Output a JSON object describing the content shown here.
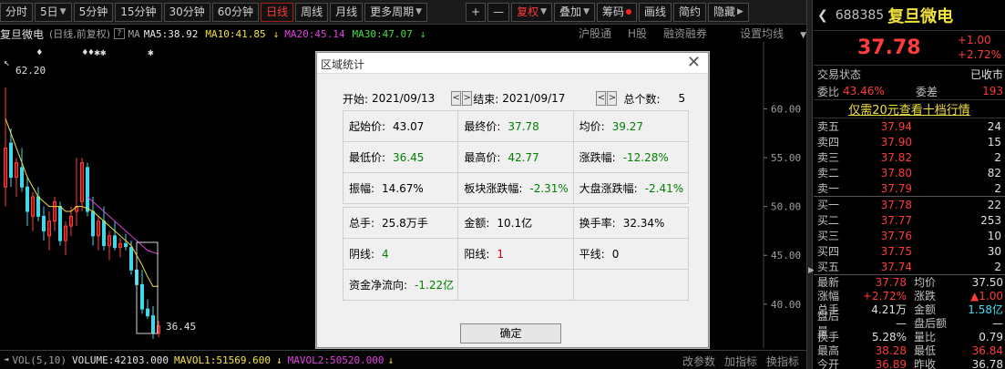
{
  "toolbar": {
    "buttons": [
      "分时",
      "5日",
      "5分钟",
      "15分钟",
      "30分钟",
      "60分钟",
      "日线",
      "周线",
      "月线",
      "更多周期"
    ],
    "plus": "+",
    "minus": "—",
    "fuquan": "复权",
    "diejia": "叠加",
    "chouma": "筹码",
    "huaxian": "画线",
    "jianyue": "简约",
    "yincang": "隐藏"
  },
  "ma_line": {
    "stock_name": "复旦微电",
    "mode": "(日线,前复权)",
    "qbox": "?",
    "ma_label": "MA",
    "ma5": "MA5:38.92",
    "ma10": "MA10:41.85",
    "ma20": "MA20:45.14",
    "ma30": "MA30:47.07",
    "arrow_down": "↓",
    "links": [
      "沪股通",
      "H股",
      "融资融券",
      "设置均线"
    ]
  },
  "chart": {
    "price_labels": [
      "60.00",
      "55.00",
      "50.00",
      "45.00",
      "40.00"
    ],
    "high_marker": "62.20",
    "low_marker": "36.45",
    "stars": [
      "♦",
      "♦♦✱✱",
      "✱"
    ]
  },
  "chart_data": {
    "type": "candlestick",
    "ylim": [
      35.5,
      65.0
    ],
    "y_ticks": [
      60.0,
      55.0,
      50.0,
      45.0,
      40.0
    ],
    "candles": [
      {
        "o": 52.0,
        "h": 62.2,
        "l": 50.0,
        "c": 56.0
      },
      {
        "o": 56.5,
        "h": 58.0,
        "l": 52.0,
        "c": 53.0
      },
      {
        "o": 53.0,
        "h": 55.0,
        "l": 51.0,
        "c": 54.5
      },
      {
        "o": 54.0,
        "h": 56.0,
        "l": 51.5,
        "c": 52.0
      },
      {
        "o": 52.0,
        "h": 53.0,
        "l": 48.0,
        "c": 49.5
      },
      {
        "o": 49.0,
        "h": 51.5,
        "l": 47.5,
        "c": 51.0
      },
      {
        "o": 51.0,
        "h": 52.0,
        "l": 48.5,
        "c": 49.0
      },
      {
        "o": 49.0,
        "h": 50.0,
        "l": 46.5,
        "c": 47.5
      },
      {
        "o": 47.0,
        "h": 49.5,
        "l": 45.5,
        "c": 48.5
      },
      {
        "o": 48.5,
        "h": 51.0,
        "l": 47.5,
        "c": 50.5
      },
      {
        "o": 50.0,
        "h": 50.5,
        "l": 46.0,
        "c": 46.5
      },
      {
        "o": 46.5,
        "h": 48.5,
        "l": 45.0,
        "c": 48.0
      },
      {
        "o": 48.0,
        "h": 50.0,
        "l": 47.0,
        "c": 49.0
      },
      {
        "o": 49.5,
        "h": 55.0,
        "l": 48.0,
        "c": 50.0
      },
      {
        "o": 50.5,
        "h": 55.0,
        "l": 49.5,
        "c": 54.5
      },
      {
        "o": 54.0,
        "h": 54.5,
        "l": 49.0,
        "c": 49.5
      },
      {
        "o": 49.5,
        "h": 51.0,
        "l": 46.0,
        "c": 47.0
      },
      {
        "o": 47.0,
        "h": 49.0,
        "l": 45.5,
        "c": 48.5
      },
      {
        "o": 48.5,
        "h": 50.0,
        "l": 45.5,
        "c": 46.0
      },
      {
        "o": 46.0,
        "h": 47.5,
        "l": 44.5,
        "c": 47.0
      },
      {
        "o": 47.0,
        "h": 48.5,
        "l": 45.5,
        "c": 45.8
      },
      {
        "o": 45.8,
        "h": 46.8,
        "l": 44.8,
        "c": 46.2
      },
      {
        "o": 46.2,
        "h": 47.2,
        "l": 45.5,
        "c": 45.9
      },
      {
        "o": 45.8,
        "h": 46.5,
        "l": 43.0,
        "c": 43.5
      },
      {
        "o": 43.5,
        "h": 44.5,
        "l": 41.5,
        "c": 42.0
      },
      {
        "o": 42.0,
        "h": 43.5,
        "l": 39.0,
        "c": 39.5
      },
      {
        "o": 39.5,
        "h": 40.5,
        "l": 38.5,
        "c": 38.8
      },
      {
        "o": 38.8,
        "h": 39.8,
        "l": 36.45,
        "c": 37.0
      },
      {
        "o": 37.0,
        "h": 38.3,
        "l": 36.6,
        "c": 37.78
      }
    ],
    "ma_series": [
      {
        "name": "MA10",
        "color": "#f0e040",
        "values": [
          59.0,
          57.5,
          56.0,
          54.5,
          53.0,
          52.0,
          51.0,
          50.5,
          50.0,
          50.0,
          50.0,
          49.5,
          49.5,
          50.0,
          50.0,
          49.8,
          49.5,
          49.0,
          48.5,
          48.0,
          47.5,
          47.0,
          46.5,
          46.0,
          45.0,
          44.0,
          42.8,
          41.8,
          41.85
        ]
      },
      {
        "name": "MA20",
        "color": "#e040e0",
        "values": [
          null,
          null,
          null,
          null,
          null,
          null,
          null,
          null,
          null,
          null,
          null,
          null,
          null,
          null,
          null,
          51.0,
          50.5,
          50.0,
          49.5,
          49.0,
          48.5,
          48.0,
          47.5,
          47.0,
          46.5,
          46.0,
          45.5,
          45.3,
          45.14
        ]
      }
    ]
  },
  "dialog": {
    "title": "区域统计",
    "close": "✕",
    "start_label": "开始:",
    "start_date": "2021/09/13",
    "end_label": "结束:",
    "end_date": "2021/09/17",
    "count_label": "总个数:",
    "count": "5",
    "nav_prev": "<",
    "nav_next": ">",
    "rows": [
      [
        {
          "label": "起始价:",
          "value": "43.07",
          "color": "black"
        },
        {
          "label": "最终价:",
          "value": "37.78",
          "color": "green"
        },
        {
          "label": "均价:",
          "value": "39.27",
          "color": "green"
        }
      ],
      [
        {
          "label": "最低价:",
          "value": "36.45",
          "color": "green"
        },
        {
          "label": "最高价:",
          "value": "42.77",
          "color": "green"
        },
        {
          "label": "涨跌幅:",
          "value": "-12.28%",
          "color": "green"
        }
      ],
      [
        {
          "label": "振幅:",
          "value": "14.67%",
          "color": "black"
        },
        {
          "label": "板块涨跌幅:",
          "value": "-2.31%",
          "color": "green"
        },
        {
          "label": "大盘涨跌幅:",
          "value": "-2.41%",
          "color": "green"
        }
      ],
      [
        {
          "label": "总手:",
          "value": "25.8万手",
          "color": "black"
        },
        {
          "label": "金额:",
          "value": "10.1亿",
          "color": "black"
        },
        {
          "label": "换手率:",
          "value": "32.34%",
          "color": "black"
        }
      ],
      [
        {
          "label": "阴线:",
          "value": "4",
          "color": "green"
        },
        {
          "label": "阳线:",
          "value": "1",
          "color": "red"
        },
        {
          "label": "平线:",
          "value": "0",
          "color": "black"
        }
      ],
      [
        {
          "label": "资金净流向:",
          "value": "-1.22亿",
          "color": "green"
        },
        {
          "label": "",
          "value": "",
          "color": "black"
        },
        {
          "label": "",
          "value": "",
          "color": "black"
        }
      ]
    ],
    "ok": "确定"
  },
  "vol_line": {
    "label": "VOL(5,10)",
    "volume": "VOLUME:42103.000",
    "mavol1": "MAVOL1:51569.600",
    "mavol2": "MAVOL2:50520.000",
    "arrow_down": "↓",
    "links": [
      "改参数",
      "加指标",
      "换指标"
    ]
  },
  "right_panel": {
    "chevron": "❮",
    "code": "688385",
    "name": "复旦微电",
    "price": "37.78",
    "change": "+1.00",
    "change_pct": "+2.72%",
    "trade_status_label": "交易状态",
    "trade_status": "已收市",
    "weibi_label": "委比",
    "weibi": "43.46%",
    "weicha_label": "委差",
    "weicha": "193",
    "link": "仅需20元查看十档行情",
    "asks": [
      {
        "label": "卖五",
        "price": "37.94",
        "vol": "24"
      },
      {
        "label": "卖四",
        "price": "37.90",
        "vol": "15"
      },
      {
        "label": "卖三",
        "price": "37.82",
        "vol": "2"
      },
      {
        "label": "卖二",
        "price": "37.80",
        "vol": "82"
      },
      {
        "label": "卖一",
        "price": "37.79",
        "vol": "2"
      }
    ],
    "bids": [
      {
        "label": "买一",
        "price": "37.78",
        "vol": "22"
      },
      {
        "label": "买二",
        "price": "37.77",
        "vol": "253"
      },
      {
        "label": "买三",
        "price": "37.76",
        "vol": "10"
      },
      {
        "label": "买四",
        "price": "37.75",
        "vol": "30"
      },
      {
        "label": "买五",
        "price": "37.74",
        "vol": "2"
      }
    ],
    "stats": [
      {
        "l1": "最新",
        "v1": "37.78",
        "c1": "red",
        "l2": "均价",
        "v2": "37.50",
        "c2": "white"
      },
      {
        "l1": "涨幅",
        "v1": "+2.72%",
        "c1": "red",
        "l2": "涨跌",
        "v2": "▲1.00",
        "c2": "red"
      },
      {
        "l1": "总手",
        "v1": "4.21万",
        "c1": "white",
        "l2": "金额",
        "v2": "1.58亿",
        "c2": "cyan"
      },
      {
        "l1": "盘后量",
        "v1": "—",
        "c1": "white",
        "l2": "盘后额",
        "v2": "—",
        "c2": "white"
      },
      {
        "l1": "换手",
        "v1": "5.28%",
        "c1": "white",
        "l2": "量比",
        "v2": "0.79",
        "c2": "white"
      },
      {
        "l1": "最高",
        "v1": "38.28",
        "c1": "red",
        "l2": "最低",
        "v2": "36.84",
        "c2": "red"
      },
      {
        "l1": "今开",
        "v1": "36.89",
        "c1": "red",
        "l2": "昨收",
        "v2": "36.78",
        "c2": "white"
      }
    ]
  }
}
